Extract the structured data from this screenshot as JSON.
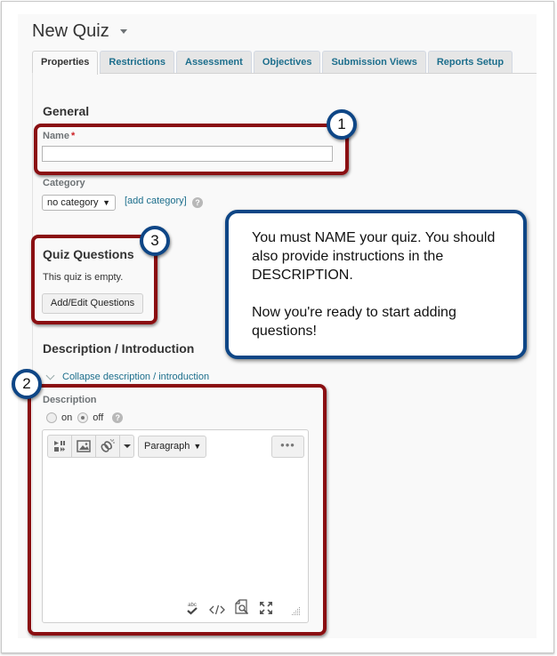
{
  "header": {
    "title": "New Quiz",
    "title_menu_icon": "caret-down-icon"
  },
  "tabs": [
    {
      "label": "Properties",
      "active": true
    },
    {
      "label": "Restrictions",
      "active": false
    },
    {
      "label": "Assessment",
      "active": false
    },
    {
      "label": "Objectives",
      "active": false
    },
    {
      "label": "Submission Views",
      "active": false
    },
    {
      "label": "Reports Setup",
      "active": false
    }
  ],
  "general": {
    "heading": "General",
    "name_label": "Name",
    "required_mark": "*",
    "name_value": "",
    "category_label": "Category",
    "category_selected": "no category",
    "add_category_link": "[add category]",
    "help_icon": "?"
  },
  "quiz_questions": {
    "heading": "Quiz Questions",
    "status_text": "This quiz is empty.",
    "add_edit_button": "Add/Edit Questions"
  },
  "description": {
    "heading": "Description / Introduction",
    "collapse_link": "Collapse description / introduction",
    "label": "Description",
    "radio_on": "on",
    "radio_off": "off",
    "selected": "off",
    "help_icon": "?",
    "editor": {
      "toolbar_icons": [
        "media-player-icon",
        "image-icon",
        "link-icon",
        "dropdown-arrow-icon"
      ],
      "format_select": "Paragraph",
      "more_button": "•••",
      "footer_icons": [
        "spellcheck-icon",
        "source-code-icon",
        "preview-icon",
        "fullscreen-icon",
        "resize-handle-icon"
      ],
      "spellcheck_text": "abc",
      "source_text": "</>",
      "content": ""
    }
  },
  "annotations": {
    "badges": [
      "1",
      "2",
      "3"
    ],
    "callout_lines": [
      "You must NAME your quiz. You should also provide instructions in the DESCRIPTION.",
      "Now you're ready to start adding questions!"
    ],
    "box_color": "#8a0f12",
    "badge_color": "#0e4686"
  }
}
